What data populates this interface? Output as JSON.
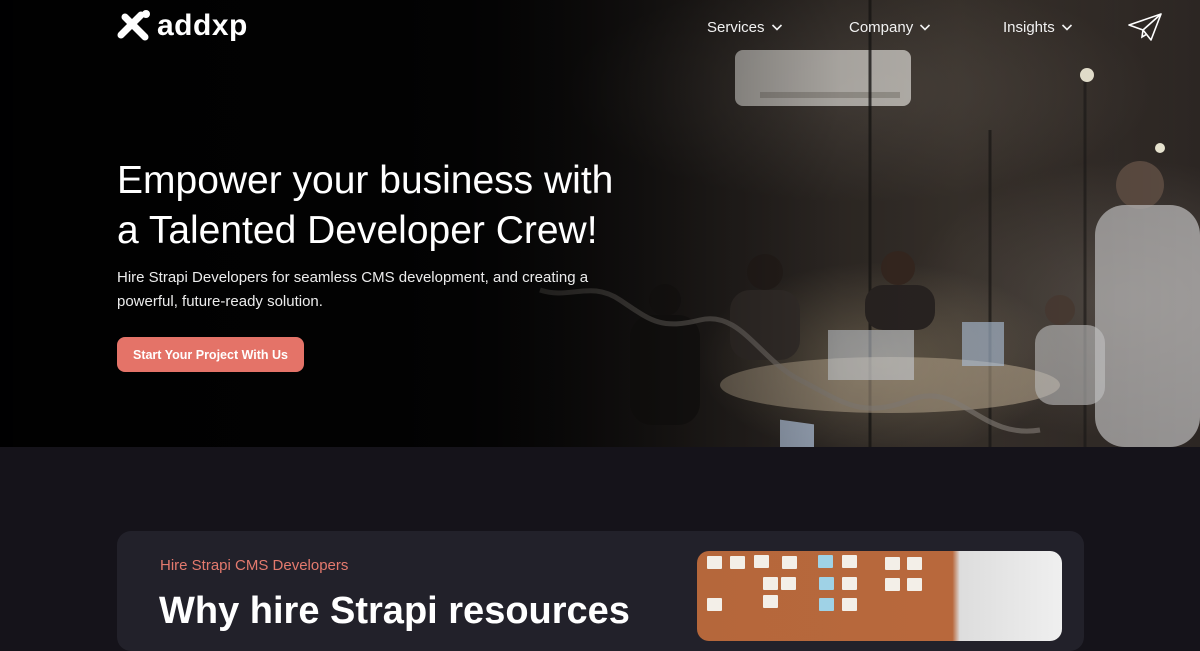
{
  "brand": {
    "name": "addxp",
    "accent": "#e47368"
  },
  "nav": {
    "items": [
      {
        "label": "Services"
      },
      {
        "label": "Company"
      },
      {
        "label": "Insights"
      }
    ]
  },
  "hero": {
    "title_line1": "Empower your business with",
    "title_line2": "a Talented Developer Crew!",
    "subtitle_line1": "Hire Strapi Developers for seamless CMS development, and creating a",
    "subtitle_line2": "powerful, future-ready solution.",
    "cta_label": "Start Your Project With Us"
  },
  "section": {
    "eyebrow": "Hire Strapi CMS Developers",
    "title": "Why hire Strapi resources"
  },
  "icons": {
    "logo": "x-mark-logo-icon",
    "dropdown": "chevron-down-icon",
    "contact": "paper-plane-icon"
  }
}
